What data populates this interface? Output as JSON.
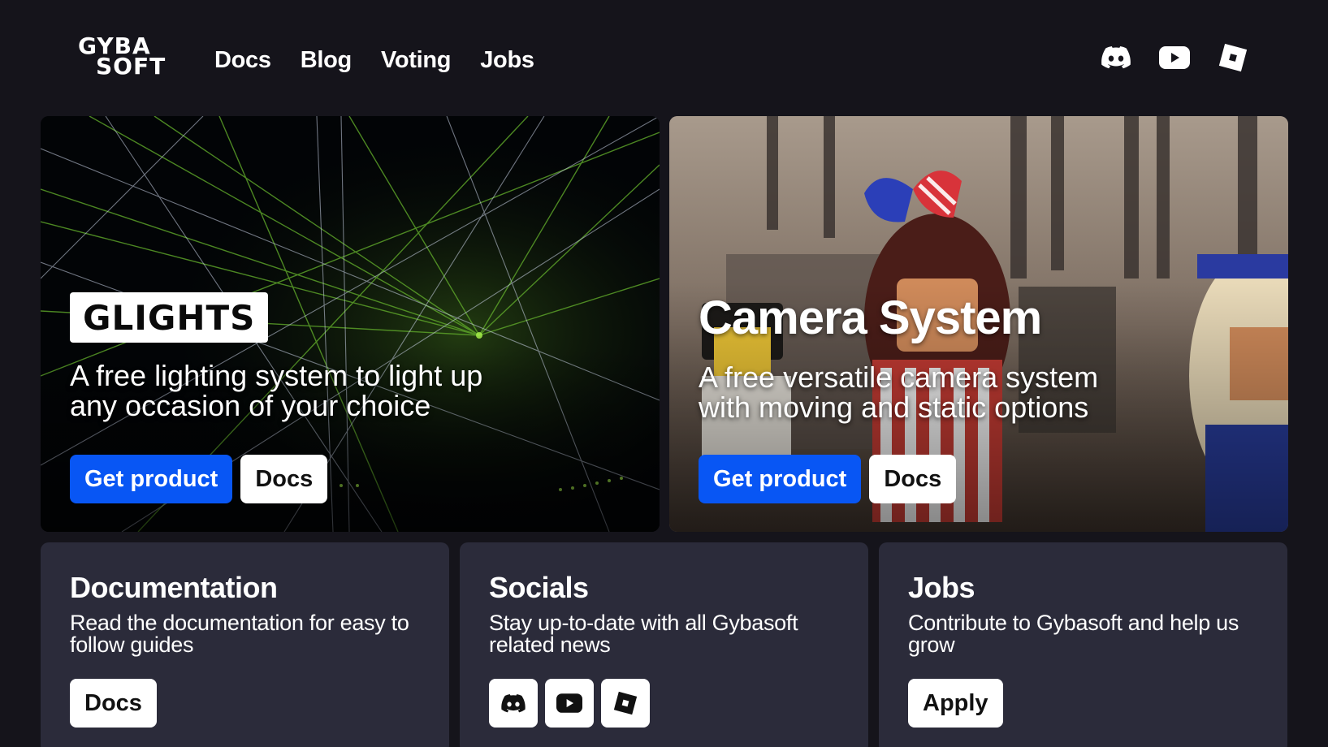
{
  "brand": {
    "logo_line1": "GYBA",
    "logo_line2": "SOFT"
  },
  "nav": {
    "links": [
      {
        "label": "Docs"
      },
      {
        "label": "Blog"
      },
      {
        "label": "Voting"
      },
      {
        "label": "Jobs"
      }
    ],
    "icons": [
      "discord-icon",
      "youtube-icon",
      "roblox-icon"
    ]
  },
  "hero": [
    {
      "badge": "GLIGHTS",
      "description": "A free lighting system to light up any occasion of your choice",
      "primary_label": "Get product",
      "secondary_label": "Docs"
    },
    {
      "title": "Camera System",
      "description": "A free versatile camera system with moving and static options",
      "primary_label": "Get product",
      "secondary_label": "Docs"
    }
  ],
  "cards": [
    {
      "title": "Documentation",
      "description": "Read the documentation for easy to follow guides",
      "button_label": "Docs"
    },
    {
      "title": "Socials",
      "description": "Stay up-to-date with all Gybasoft related news",
      "icons": [
        "discord-icon",
        "youtube-icon",
        "roblox-icon"
      ]
    },
    {
      "title": "Jobs",
      "description": "Contribute to Gybasoft and help us grow",
      "button_label": "Apply"
    }
  ],
  "colors": {
    "background": "#15141b",
    "card": "#2b2b3a",
    "primary_button": "#0856f4"
  }
}
